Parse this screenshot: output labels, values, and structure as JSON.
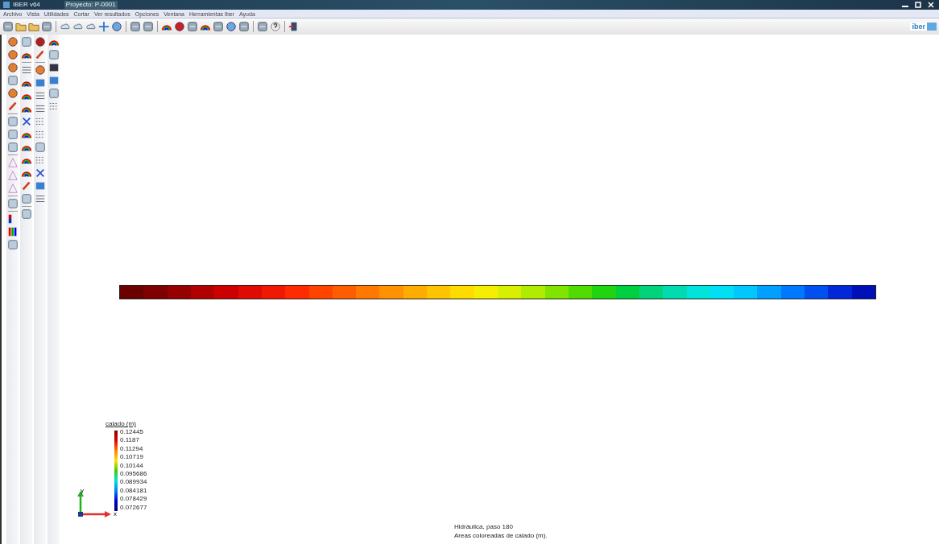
{
  "window": {
    "app_title": "IBER v64",
    "project_title": "Proyecto: P-0001"
  },
  "menu": [
    "Archivo",
    "Vista",
    "Utilidades",
    "Cortar",
    "Ver resultados",
    "Opciones",
    "Ventana",
    "Herramientas Iber",
    "Ayuda"
  ],
  "logo": {
    "text": "iber"
  },
  "legend": {
    "title": "calado (m)",
    "labels": [
      "0.12445",
      "0.1187",
      "0.11294",
      "0.10719",
      "0.10144",
      "0.095686",
      "0.089934",
      "0.084181",
      "0.078429",
      "0.072677"
    ]
  },
  "axes": {
    "x_label": "x",
    "y_label": "y"
  },
  "status_lines": [
    "Hidráulica, paso 180",
    "Areas coloreadas de calado (m)."
  ]
}
